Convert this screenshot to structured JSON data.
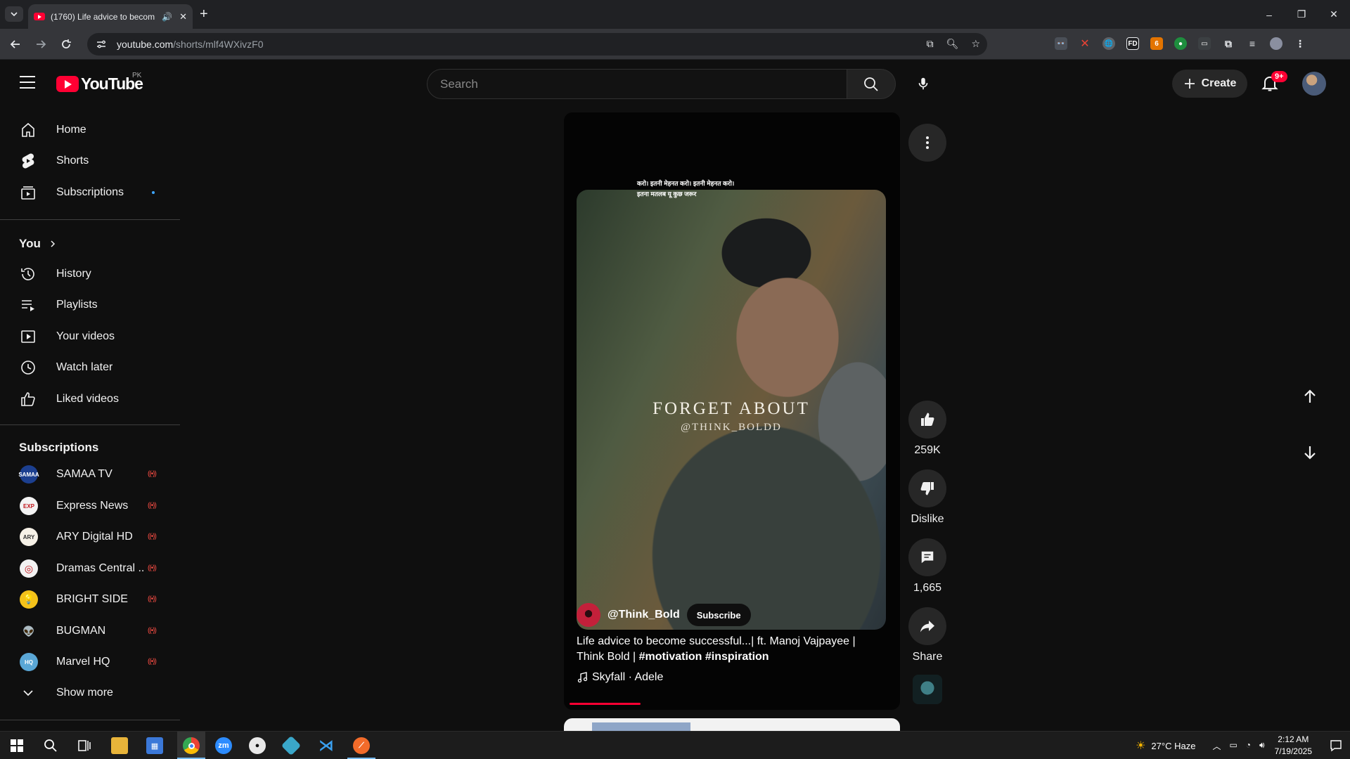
{
  "browser": {
    "tab_title": "(1760) Life advice to becom",
    "url_host": "youtube.com",
    "url_path": "/shorts/mlf4WXivzF0",
    "window_controls": [
      "–",
      "❐",
      "✕"
    ]
  },
  "masthead": {
    "logo_text": "YouTube",
    "country": "PK",
    "search_placeholder": "Search",
    "create_label": "Create",
    "notification_badge": "9+"
  },
  "sidebar": {
    "main": [
      {
        "label": "Home",
        "icon": "home-icon"
      },
      {
        "label": "Shorts",
        "icon": "shorts-icon"
      },
      {
        "label": "Subscriptions",
        "icon": "subscriptions-icon"
      }
    ],
    "you_heading": "You",
    "you_items": [
      {
        "label": "History",
        "icon": "history-icon"
      },
      {
        "label": "Playlists",
        "icon": "playlists-icon"
      },
      {
        "label": "Your videos",
        "icon": "your-videos-icon"
      },
      {
        "label": "Watch later",
        "icon": "watch-later-icon"
      },
      {
        "label": "Liked videos",
        "icon": "liked-videos-icon"
      }
    ],
    "subscriptions_heading": "Subscriptions",
    "subscriptions": [
      {
        "label": "SAMAA TV",
        "color": "#1c3f8f",
        "text": "SAMAA"
      },
      {
        "label": "Express News",
        "color": "#f3f3f3",
        "text": "EXP"
      },
      {
        "label": "ARY Digital HD",
        "color": "#f6f1e7",
        "text": "ARY"
      },
      {
        "label": "Dramas Central ...",
        "color": "#f2f2f2",
        "text": "◎"
      },
      {
        "label": "BRIGHT SIDE",
        "color": "#f4c21a",
        "text": "💡"
      },
      {
        "label": "BUGMAN",
        "color": "#0f0f0f",
        "text": "👽"
      },
      {
        "label": "Marvel HQ",
        "color": "#5aa7d6",
        "text": "HQ"
      }
    ],
    "show_more": "Show more"
  },
  "short": {
    "top_caption_line1": "करो। इतनी मेहनत करो। इतनी मेहनत करो।",
    "top_caption_line2": "इतना मतलब यू कुछ जरूर",
    "overlay_text": "FORGET ABOUT",
    "overlay_handle": "@THINK_BOLDD",
    "channel": "@Think_Bold",
    "subscribe_label": "Subscribe",
    "title_plain": "Life advice to become successful...| ft. Manoj Vajpayee | Think Bold | ",
    "title_hashtags": "#motivation #inspiration",
    "music": "Skyfall · Adele",
    "progress": 0.22
  },
  "actions": {
    "likes": "259K",
    "dislike_label": "Dislike",
    "comments": "1,665",
    "share_label": "Share"
  },
  "taskbar": {
    "weather": "27°C  Haze",
    "time": "2:12 AM",
    "date": "7/19/2025"
  }
}
